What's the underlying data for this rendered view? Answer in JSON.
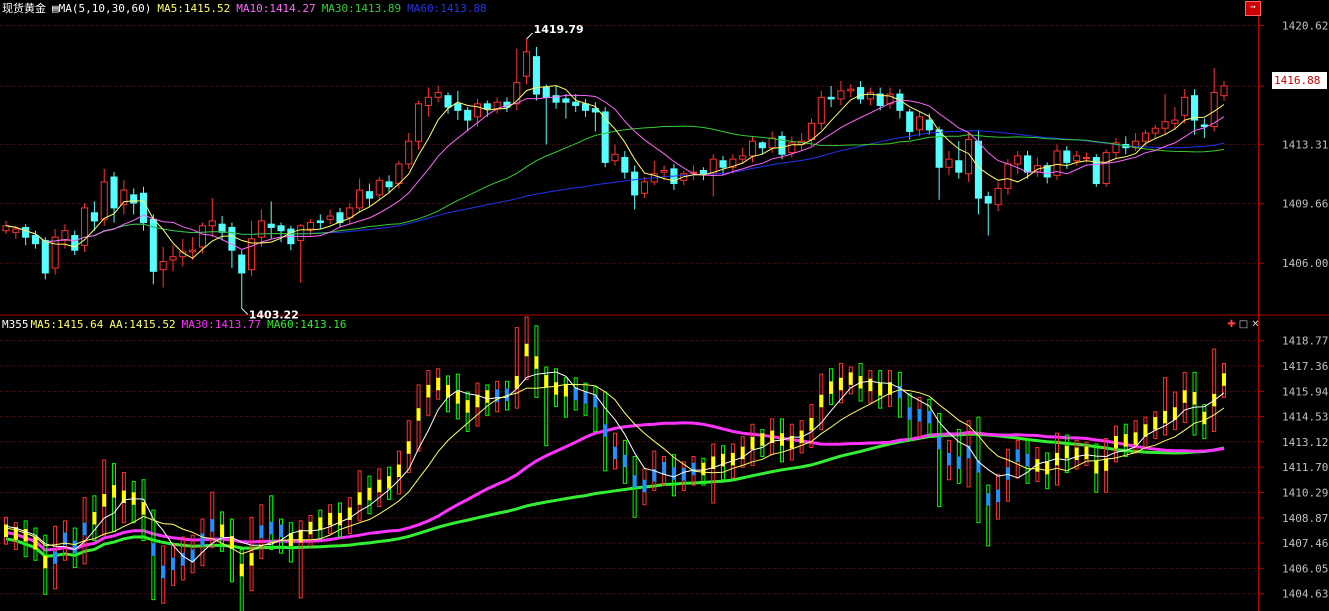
{
  "panel1": {
    "title": "现货黄金",
    "ma_label": "MA(5,10,30,60)",
    "ma5": "MA5:1415.52",
    "ma10": "MA10:1414.27",
    "ma30": "MA30:1413.89",
    "ma60": "MA60:1413.88",
    "high_label": "1419.79",
    "low_label": "1403.22",
    "price_label": "1416.88",
    "yticks": [
      "1420.62",
      "1416.88",
      "1413.31",
      "1409.66",
      "1406.00"
    ]
  },
  "panel2": {
    "title": "M355",
    "ma5": "MA5:1415.64",
    "aa": "AA:1415.52",
    "ma30": "MA30:1413.77",
    "ma60": "MA60:1413.16",
    "yticks": [
      "1418.77",
      "1417.36",
      "1415.94",
      "1414.53",
      "1413.12",
      "1411.70",
      "1410.29",
      "1408.87",
      "1407.46",
      "1406.05",
      "1404.63"
    ]
  },
  "colors": {
    "up": "#ff3232",
    "down": "#54ffff",
    "ma5": "#ffff66",
    "ma10": "#ff66ff",
    "ma30": "#33cc33",
    "ma60": "#2233ee",
    "grid": "#7a0000",
    "m_up": "#ff3232",
    "m_down": "#00ff00",
    "m_ma30": "#ff33ff",
    "m_ma60": "#33ee33"
  },
  "chart_data": {
    "type": "candlestick",
    "candles": [
      [
        1408.0,
        1408.3,
        1407.8,
        1408.6
      ],
      [
        1407.9,
        1408.1,
        1407.5,
        1408.3
      ],
      [
        1408.2,
        1407.6,
        1407.1,
        1408.4
      ],
      [
        1407.7,
        1407.2,
        1406.9,
        1408.0
      ],
      [
        1407.4,
        1405.4,
        1405.0,
        1407.6
      ],
      [
        1405.7,
        1407.6,
        1405.3,
        1408.1
      ],
      [
        1407.4,
        1408.0,
        1406.9,
        1408.4
      ],
      [
        1407.7,
        1406.8,
        1406.5,
        1408.0
      ],
      [
        1407.1,
        1409.4,
        1406.7,
        1409.7
      ],
      [
        1409.1,
        1408.6,
        1408.0,
        1409.8
      ],
      [
        1408.7,
        1411.0,
        1408.3,
        1411.8
      ],
      [
        1411.3,
        1409.4,
        1408.5,
        1411.6
      ],
      [
        1409.6,
        1410.5,
        1409.0,
        1411.1
      ],
      [
        1410.2,
        1409.7,
        1409.0,
        1410.6
      ],
      [
        1410.3,
        1408.5,
        1408.0,
        1410.7
      ],
      [
        1408.7,
        1405.5,
        1404.7,
        1409.0
      ],
      [
        1405.6,
        1406.1,
        1404.5,
        1407.0
      ],
      [
        1406.2,
        1406.4,
        1405.5,
        1407.1
      ],
      [
        1406.4,
        1406.7,
        1405.8,
        1407.5
      ],
      [
        1406.7,
        1406.8,
        1406.2,
        1407.6
      ],
      [
        1407.0,
        1408.3,
        1406.6,
        1408.5
      ],
      [
        1408.3,
        1408.6,
        1407.6,
        1410.0
      ],
      [
        1408.4,
        1407.9,
        1407.4,
        1408.9
      ],
      [
        1408.2,
        1406.8,
        1405.7,
        1408.5
      ],
      [
        1406.5,
        1405.4,
        1403.22,
        1406.8
      ],
      [
        1405.6,
        1407.5,
        1405.2,
        1408.6
      ],
      [
        1407.6,
        1408.6,
        1407.0,
        1409.3
      ],
      [
        1408.4,
        1408.2,
        1407.5,
        1409.8
      ],
      [
        1408.3,
        1408.0,
        1407.3,
        1408.5
      ],
      [
        1408.1,
        1407.2,
        1406.8,
        1408.3
      ],
      [
        1407.4,
        1408.3,
        1404.8,
        1408.4
      ],
      [
        1408.1,
        1408.5,
        1407.7,
        1408.7
      ],
      [
        1408.6,
        1408.5,
        1408.1,
        1409.0
      ],
      [
        1408.7,
        1408.9,
        1408.4,
        1409.3
      ],
      [
        1409.1,
        1408.5,
        1408.2,
        1409.4
      ],
      [
        1408.8,
        1409.4,
        1408.4,
        1409.7
      ],
      [
        1409.4,
        1410.5,
        1409.1,
        1411.2
      ],
      [
        1410.4,
        1410.0,
        1409.5,
        1410.9
      ],
      [
        1410.2,
        1411.1,
        1409.9,
        1411.3
      ],
      [
        1411.0,
        1410.7,
        1410.3,
        1411.4
      ],
      [
        1410.9,
        1412.1,
        1410.6,
        1412.3
      ],
      [
        1412.1,
        1413.5,
        1411.8,
        1414.0
      ],
      [
        1413.5,
        1415.8,
        1413.0,
        1416.0
      ],
      [
        1415.7,
        1416.2,
        1415.0,
        1416.8
      ],
      [
        1416.2,
        1416.5,
        1415.9,
        1416.9
      ],
      [
        1416.3,
        1415.6,
        1415.2,
        1416.5
      ],
      [
        1415.8,
        1415.4,
        1414.8,
        1416.6
      ],
      [
        1415.4,
        1414.8,
        1414.1,
        1415.6
      ],
      [
        1415.0,
        1415.8,
        1414.4,
        1416.1
      ],
      [
        1415.8,
        1415.5,
        1415.0,
        1416.0
      ],
      [
        1415.5,
        1415.9,
        1415.2,
        1416.2
      ],
      [
        1415.9,
        1415.6,
        1415.3,
        1416.2
      ],
      [
        1415.8,
        1417.1,
        1415.4,
        1419.2
      ],
      [
        1417.5,
        1419.0,
        1417.0,
        1419.79
      ],
      [
        1418.7,
        1416.4,
        1416.0,
        1419.3
      ],
      [
        1416.8,
        1416.2,
        1413.3,
        1417.0
      ],
      [
        1416.3,
        1415.9,
        1415.5,
        1416.9
      ],
      [
        1416.1,
        1415.9,
        1414.9,
        1416.4
      ],
      [
        1415.9,
        1415.7,
        1415.3,
        1416.4
      ],
      [
        1415.8,
        1415.4,
        1415.0,
        1416.1
      ],
      [
        1415.5,
        1415.3,
        1414.1,
        1415.9
      ],
      [
        1415.3,
        1412.2,
        1411.9,
        1415.6
      ],
      [
        1412.3,
        1412.7,
        1412.0,
        1413.3
      ],
      [
        1412.5,
        1411.6,
        1411.2,
        1412.9
      ],
      [
        1411.6,
        1410.2,
        1409.3,
        1412.0
      ],
      [
        1410.3,
        1411.0,
        1410.0,
        1411.3
      ],
      [
        1411.0,
        1411.5,
        1410.8,
        1412.3
      ],
      [
        1411.6,
        1411.7,
        1411.1,
        1412.0
      ],
      [
        1411.8,
        1410.9,
        1410.5,
        1412.1
      ],
      [
        1411.1,
        1411.5,
        1410.8,
        1411.7
      ],
      [
        1411.6,
        1411.6,
        1411.1,
        1412.0
      ],
      [
        1411.7,
        1411.5,
        1411.1,
        1411.9
      ],
      [
        1411.5,
        1412.4,
        1410.1,
        1412.7
      ],
      [
        1412.3,
        1411.9,
        1411.4,
        1412.6
      ],
      [
        1411.9,
        1412.4,
        1411.5,
        1412.7
      ],
      [
        1412.4,
        1412.6,
        1412.1,
        1413.1
      ],
      [
        1412.6,
        1413.5,
        1412.2,
        1413.8
      ],
      [
        1413.4,
        1413.1,
        1412.7,
        1413.5
      ],
      [
        1413.1,
        1413.7,
        1412.8,
        1414.1
      ],
      [
        1413.8,
        1412.7,
        1412.4,
        1414.1
      ],
      [
        1412.8,
        1413.4,
        1412.5,
        1413.8
      ],
      [
        1413.3,
        1413.5,
        1412.9,
        1414.0
      ],
      [
        1413.6,
        1414.6,
        1413.2,
        1414.9
      ],
      [
        1414.6,
        1416.2,
        1414.2,
        1416.6
      ],
      [
        1416.2,
        1416.1,
        1415.6,
        1416.9
      ],
      [
        1416.1,
        1416.6,
        1415.7,
        1417.2
      ],
      [
        1416.6,
        1416.7,
        1416.2,
        1417.0
      ],
      [
        1416.8,
        1416.1,
        1415.8,
        1417.2
      ],
      [
        1416.1,
        1416.5,
        1415.7,
        1416.8
      ],
      [
        1416.4,
        1415.7,
        1415.4,
        1416.8
      ],
      [
        1415.8,
        1416.4,
        1415.5,
        1416.8
      ],
      [
        1416.4,
        1415.4,
        1414.9,
        1416.7
      ],
      [
        1415.3,
        1414.1,
        1413.6,
        1415.5
      ],
      [
        1414.2,
        1415.0,
        1413.8,
        1415.3
      ],
      [
        1414.8,
        1414.2,
        1413.9,
        1415.2
      ],
      [
        1414.2,
        1411.9,
        1409.9,
        1414.4
      ],
      [
        1411.9,
        1412.4,
        1411.4,
        1412.9
      ],
      [
        1412.3,
        1411.6,
        1411.2,
        1413.5
      ],
      [
        1411.5,
        1413.6,
        1411.0,
        1414.0
      ],
      [
        1413.5,
        1410.0,
        1409.0,
        1414.2
      ],
      [
        1410.1,
        1409.7,
        1407.7,
        1410.4
      ],
      [
        1409.6,
        1410.6,
        1409.2,
        1411.0
      ],
      [
        1410.6,
        1412.1,
        1410.2,
        1412.4
      ],
      [
        1412.1,
        1412.6,
        1411.5,
        1412.9
      ],
      [
        1412.6,
        1411.6,
        1411.2,
        1412.9
      ],
      [
        1411.6,
        1412.0,
        1411.3,
        1412.5
      ],
      [
        1412.0,
        1411.3,
        1410.9,
        1412.2
      ],
      [
        1411.4,
        1412.9,
        1411.1,
        1413.3
      ],
      [
        1412.9,
        1412.2,
        1411.8,
        1413.2
      ],
      [
        1412.3,
        1412.6,
        1412.0,
        1412.9
      ],
      [
        1412.5,
        1412.5,
        1412.2,
        1412.8
      ],
      [
        1412.5,
        1410.9,
        1410.7,
        1412.7
      ],
      [
        1410.9,
        1412.8,
        1410.7,
        1413.0
      ],
      [
        1412.8,
        1413.4,
        1412.4,
        1413.7
      ],
      [
        1413.3,
        1413.1,
        1412.7,
        1413.8
      ],
      [
        1413.1,
        1413.5,
        1412.9,
        1414.0
      ],
      [
        1413.5,
        1414.0,
        1413.2,
        1414.2
      ],
      [
        1414.0,
        1414.3,
        1413.7,
        1414.5
      ],
      [
        1414.3,
        1414.7,
        1413.9,
        1416.4
      ],
      [
        1414.6,
        1414.8,
        1414.2,
        1415.6
      ],
      [
        1415.1,
        1416.2,
        1414.6,
        1416.7
      ],
      [
        1416.3,
        1414.8,
        1413.9,
        1416.7
      ],
      [
        1414.5,
        1414.4,
        1413.7,
        1414.9
      ],
      [
        1414.4,
        1416.5,
        1414.1,
        1418.0
      ],
      [
        1416.3,
        1416.9,
        1416.0,
        1417.2
      ]
    ],
    "ma5_endpoints": {
      "first": 1408.3,
      "last": 1415.52
    },
    "ma10_last": 1414.27,
    "ma30_last": 1413.89,
    "ma60_last": 1413.88,
    "yrange_top": [
      1403.0,
      1421.2
    ],
    "yrange_bottom": [
      1404.0,
      1419.2
    ]
  }
}
